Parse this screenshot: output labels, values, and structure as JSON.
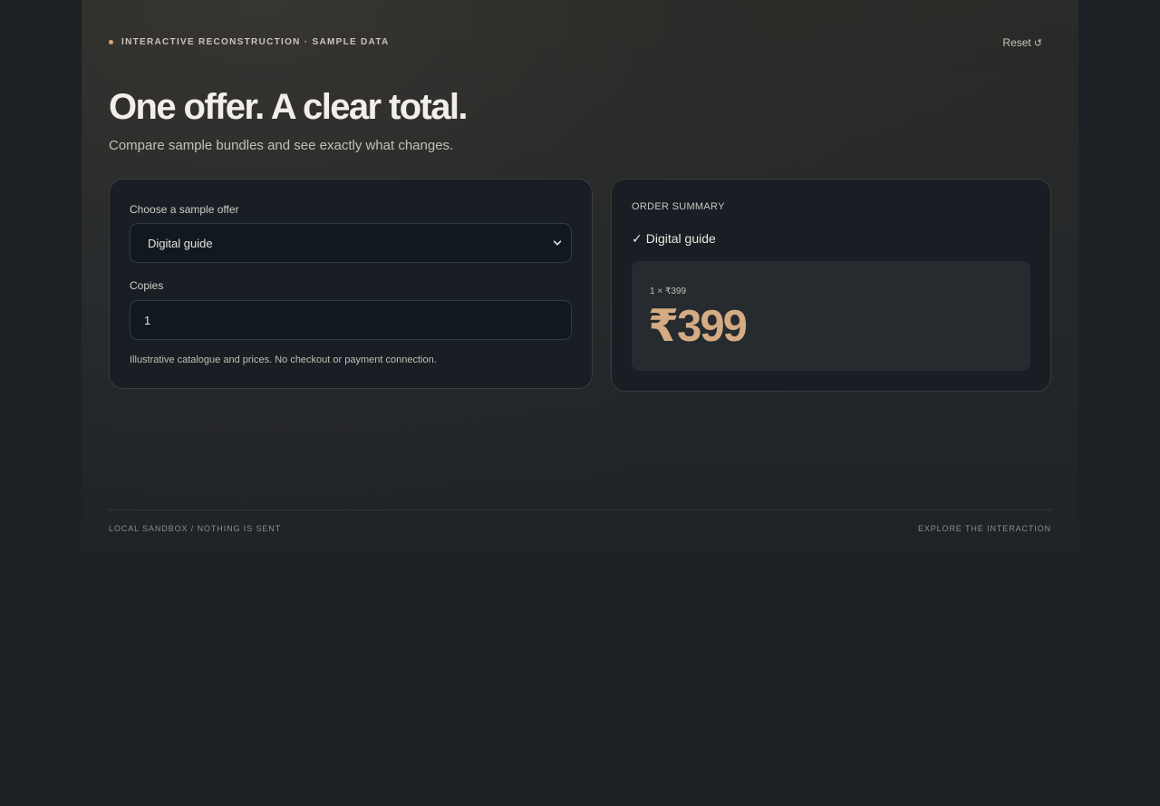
{
  "header": {
    "eyebrow": "INTERACTIVE RECONSTRUCTION · SAMPLE DATA",
    "reset_label": "Reset",
    "reset_icon": "↺"
  },
  "hero": {
    "title": "One offer. A clear total.",
    "subtitle": "Compare sample bundles and see exactly what changes."
  },
  "form": {
    "offer_label": "Choose a sample offer",
    "offer_selected": "Digital guide",
    "copies_label": "Copies",
    "copies_value": "1",
    "note": "Illustrative catalogue and prices. No checkout or payment connection."
  },
  "summary": {
    "heading": "ORDER SUMMARY",
    "check": "✓",
    "item": "Digital guide",
    "calculation": "1 × ₹399",
    "total": "₹399"
  },
  "footer": {
    "left": "LOCAL SANDBOX / NOTHING IS SENT",
    "right": "EXPLORE THE INTERACTION"
  },
  "colors": {
    "accent": "#d4ab82",
    "background": "#1d2125",
    "card": "#191e24",
    "border": "#33403c"
  },
  "icons": {
    "reset": "reset-icon",
    "select": "chevron-down-icon",
    "check": "check-icon"
  }
}
